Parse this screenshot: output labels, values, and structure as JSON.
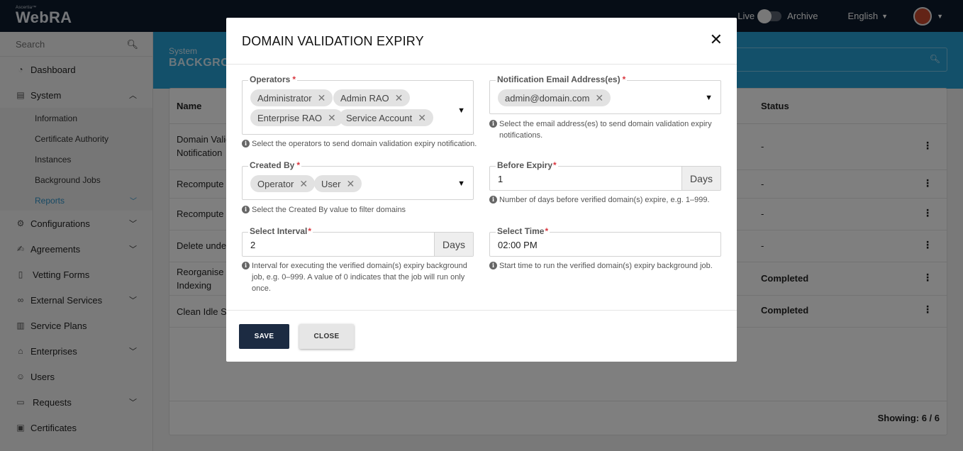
{
  "app": {
    "logo_small": "Ascertia™",
    "logo_big": "WebRA",
    "live_label": "Live",
    "archive_label": "Archive",
    "language": "English"
  },
  "sidebar": {
    "search_placeholder": "Search",
    "items": {
      "dashboard": "Dashboard",
      "system": "System",
      "configurations": "Configurations",
      "agreements": "Agreements",
      "vetting_forms": "Vetting Forms",
      "external_services": "External Services",
      "service_plans": "Service Plans",
      "enterprises": "Enterprises",
      "users": "Users",
      "requests": "Requests",
      "certificates": "Certificates"
    },
    "system_sub": {
      "information": "Information",
      "certificate_authority": "Certificate Authority",
      "instances": "Instances",
      "background_jobs": "Background Jobs",
      "reports": "Reports"
    }
  },
  "page": {
    "breadcrumb": "System",
    "title": "BACKGRO"
  },
  "table": {
    "col_name": "Name",
    "col_status": "Status",
    "rows": [
      {
        "name_line1": "Domain Valid",
        "name_line2": "Notification",
        "status": "-"
      },
      {
        "name_line1": "Recompute I",
        "name_line2": "",
        "status": "-"
      },
      {
        "name_line1": "Recompute U",
        "name_line2": "",
        "status": "-"
      },
      {
        "name_line1": "Delete undel",
        "name_line2": "",
        "status": "-"
      },
      {
        "name_line1": "Reorganise c",
        "name_line2": "Indexing",
        "status": "Completed"
      },
      {
        "name_line1": "Clean Idle Se",
        "name_line2": "",
        "status": "Completed"
      }
    ],
    "showing": "Showing:  6 / 6"
  },
  "modal": {
    "title": "DOMAIN VALIDATION EXPIRY",
    "operators": {
      "label": "Operators",
      "chips": [
        "Administrator",
        "Admin RAO",
        "Enterprise RAO",
        "Service Account"
      ],
      "help": "Select the operators to send domain validation expiry notification."
    },
    "notification_email": {
      "label": "Notification Email Address(es)",
      "chips": [
        "admin@domain.com"
      ],
      "help_line1": "Select the email address(es) to send domain validation expiry",
      "help_line2": "notifications."
    },
    "created_by": {
      "label": "Created By",
      "chips": [
        "Operator",
        "User"
      ],
      "help": "Select the Created By value to filter domains"
    },
    "before_expiry": {
      "label": "Before Expiry",
      "value": "1",
      "addon": "Days",
      "help": "Number of days before verified domain(s) expire, e.g. 1–999."
    },
    "select_interval": {
      "label": "Select Interval",
      "value": "2",
      "addon": "Days",
      "help_line1": "Interval for executing the verified domain(s) expiry background",
      "help_line2": "job, e.g. 0–999. A value of 0 indicates that the job will run only",
      "help_line3": "once."
    },
    "select_time": {
      "label": "Select Time",
      "value": "02:00 PM",
      "help": "Start time to run the verified domain(s) expiry background job."
    },
    "save_label": "SAVE",
    "close_label": "CLOSE",
    "required_mark": "*",
    "chip_remove": "✕",
    "info_mark": "i"
  },
  "colors": {
    "topbar": "#0d1a2d",
    "banner": "#27a1d4",
    "save_button": "#1c2b42",
    "required": "#d9363e",
    "active_link": "#2e93c9"
  }
}
